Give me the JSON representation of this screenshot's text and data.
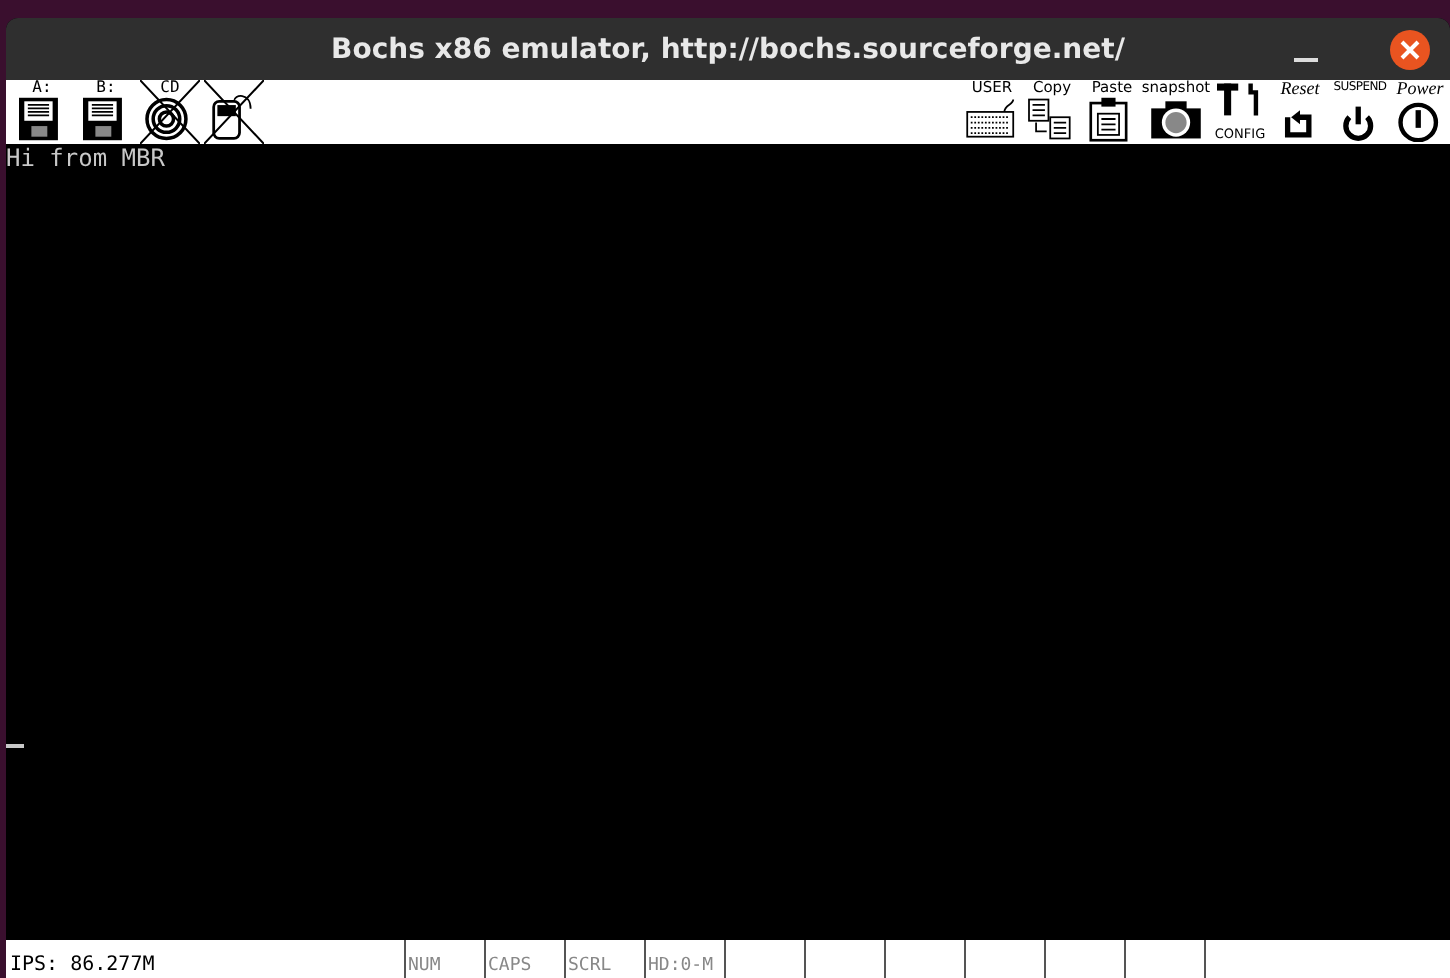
{
  "window": {
    "title": "Bochs x86 emulator, http://bochs.sourceforge.net/"
  },
  "toolbar_left": [
    {
      "kind": "floppy",
      "label": "A:",
      "disabled": false
    },
    {
      "kind": "floppy",
      "label": "B:",
      "disabled": false
    },
    {
      "kind": "cdrom",
      "label": "CD",
      "disabled": true
    },
    {
      "kind": "mouse",
      "disabled": true
    }
  ],
  "toolbar_right": [
    {
      "kind": "user",
      "label": "USER"
    },
    {
      "kind": "copy",
      "label": "Copy"
    },
    {
      "kind": "paste",
      "label": "Paste"
    },
    {
      "kind": "snapshot",
      "label": "snapshot"
    },
    {
      "kind": "config",
      "label": "CONFIG"
    },
    {
      "kind": "reset",
      "label": "Reset"
    },
    {
      "kind": "suspend",
      "label": "SUSPEND"
    },
    {
      "kind": "power",
      "label": "Power"
    }
  ],
  "screen": {
    "lines": [
      "Hi from MBR"
    ]
  },
  "status_bar": {
    "ips": "IPS: 86.277M",
    "indicators": [
      {
        "label": "NUM",
        "on": false
      },
      {
        "label": "CAPS",
        "on": false
      },
      {
        "label": "SCRL",
        "on": false
      },
      {
        "label": "HD:0-M",
        "on": false
      }
    ]
  }
}
